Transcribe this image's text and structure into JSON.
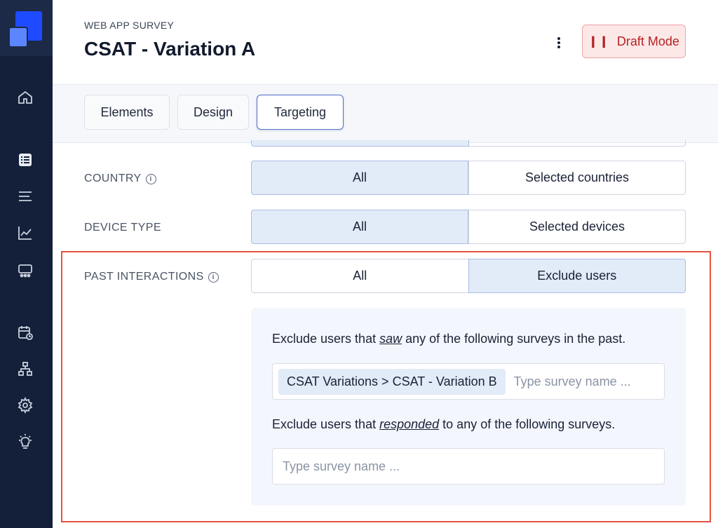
{
  "header": {
    "eyebrow": "WEB APP SURVEY",
    "title": "CSAT - Variation A",
    "status_button": "Draft Mode",
    "status_icon": "pause-icon"
  },
  "tabs": [
    {
      "label": "Elements",
      "active": false
    },
    {
      "label": "Design",
      "active": false
    },
    {
      "label": "Targeting",
      "active": true
    }
  ],
  "sidebar": {
    "items": [
      {
        "icon": "home-icon"
      },
      {
        "icon": "survey-list-icon"
      },
      {
        "icon": "menu-lines-icon"
      },
      {
        "icon": "chart-icon"
      },
      {
        "icon": "audience-icon"
      },
      {
        "icon": "calendar-clock-icon"
      },
      {
        "icon": "hierarchy-icon"
      },
      {
        "icon": "gear-icon"
      },
      {
        "icon": "lightbulb-icon"
      }
    ]
  },
  "targeting": {
    "country": {
      "label": "COUNTRY",
      "options": [
        "All",
        "Selected countries"
      ],
      "selected": "All"
    },
    "device_type": {
      "label": "DEVICE TYPE",
      "options": [
        "All",
        "Selected devices"
      ],
      "selected": "All"
    },
    "past_interactions": {
      "label": "PAST INTERACTIONS",
      "options": [
        "All",
        "Exclude users"
      ],
      "selected": "Exclude users",
      "saw_prefix": "Exclude users that ",
      "saw_word": "saw",
      "saw_suffix": " any of the following surveys in the past.",
      "saw_chip": "CSAT Variations > CSAT - Variation B",
      "saw_placeholder": "Type survey name ...",
      "responded_prefix": "Exclude users that ",
      "responded_word": "responded",
      "responded_suffix": " to any of the following surveys.",
      "responded_placeholder": "Type survey name ..."
    }
  },
  "colors": {
    "sidebar": "#14203a",
    "accent": "#1e4bff",
    "draft": "#b42323",
    "selected_segment": "#e2ebf8",
    "highlight": "#e5533f"
  }
}
